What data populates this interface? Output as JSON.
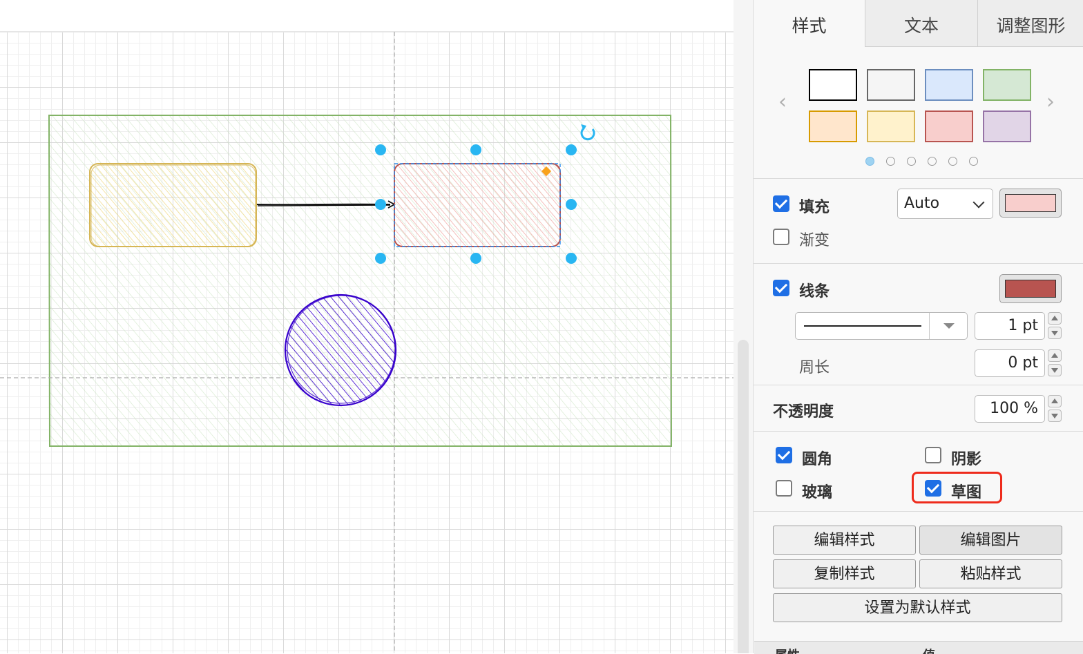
{
  "tabs": [
    "样式",
    "文本",
    "调整图形"
  ],
  "palette": {
    "swatches": [
      {
        "fill": "#ffffff",
        "stroke": "#000000"
      },
      {
        "fill": "#f5f5f5",
        "stroke": "#666666"
      },
      {
        "fill": "#dae8fc",
        "stroke": "#6c8ebf"
      },
      {
        "fill": "#d5e8d4",
        "stroke": "#82b366"
      },
      {
        "fill": "#ffe6cc",
        "stroke": "#d79b00"
      },
      {
        "fill": "#fff2cc",
        "stroke": "#d6b656"
      },
      {
        "fill": "#f8cecc",
        "stroke": "#b85450"
      },
      {
        "fill": "#e1d5e7",
        "stroke": "#9673a6"
      }
    ],
    "page_count": 6,
    "current_page": 1
  },
  "fill": {
    "label": "填充",
    "checked": true,
    "mode": "Auto",
    "color": "#f8cecc"
  },
  "gradient": {
    "label": "渐变",
    "checked": false
  },
  "line": {
    "label": "线条",
    "checked": true,
    "color": "#b85450",
    "width": "1 pt"
  },
  "perimeter": {
    "label": "周长",
    "value": "0 pt"
  },
  "opacity": {
    "label": "不透明度",
    "value": "100 %"
  },
  "options": {
    "rounded": {
      "label": "圆角",
      "checked": true
    },
    "shadow": {
      "label": "阴影",
      "checked": false
    },
    "glass": {
      "label": "玻璃",
      "checked": false
    },
    "sketch": {
      "label": "草图",
      "checked": true
    }
  },
  "buttons": {
    "edit_style": "编辑样式",
    "edit_image": "编辑图片",
    "copy_style": "复制样式",
    "paste_style": "粘贴样式",
    "set_default": "设置为默认样式"
  },
  "bottom": {
    "property": "属性",
    "value": "值"
  },
  "diagram_colors": {
    "container": "#82b366",
    "left_box": "#d6b656",
    "selected_box": "#b85450",
    "circle": "#3700CC",
    "handle": "#29b6f2"
  }
}
